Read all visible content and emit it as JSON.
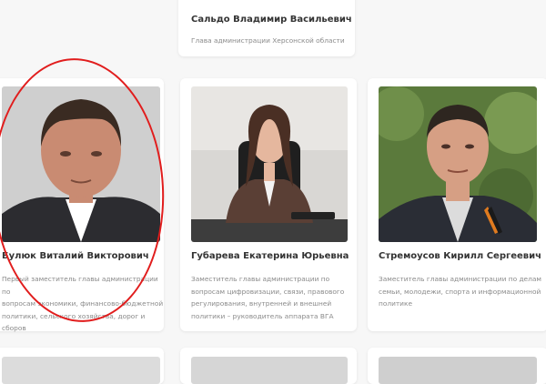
{
  "top_card": {
    "name": "Сальдо Владимир Васильевич",
    "role": "Глава администрации Херсонской области"
  },
  "cards": [
    {
      "name": "Булюк Виталий Викторович",
      "role_lines": [
        "Первый заместитель главы администрации по",
        "вопросам экономики, финансово-бюджетной",
        "политики, сельского хозяйства, дорог и",
        "сборов"
      ],
      "photo_icon": "man-portrait-photo"
    },
    {
      "name": "Губарева Екатерина Юрьевна",
      "role_lines": [
        "Заместитель главы администрации по",
        "вопросам цифровизации, связи, правового",
        "регулирования, внутренней и внешней",
        "политики – руководитель аппарата ВГА"
      ],
      "photo_icon": "woman-portrait-photo"
    },
    {
      "name": "Стремоусов Кирилл Сергеевич",
      "role_lines": [
        "Заместитель главы администрации по делам",
        "семьи, молодежи, спорта и информационной",
        "политике"
      ],
      "photo_icon": "man-portrait-photo"
    }
  ],
  "colors": {
    "background": "#f7f7f7",
    "card": "#ffffff",
    "highlight_circle": "#e11d1d",
    "name_text": "#333333",
    "role_text": "#8a8a8a"
  }
}
